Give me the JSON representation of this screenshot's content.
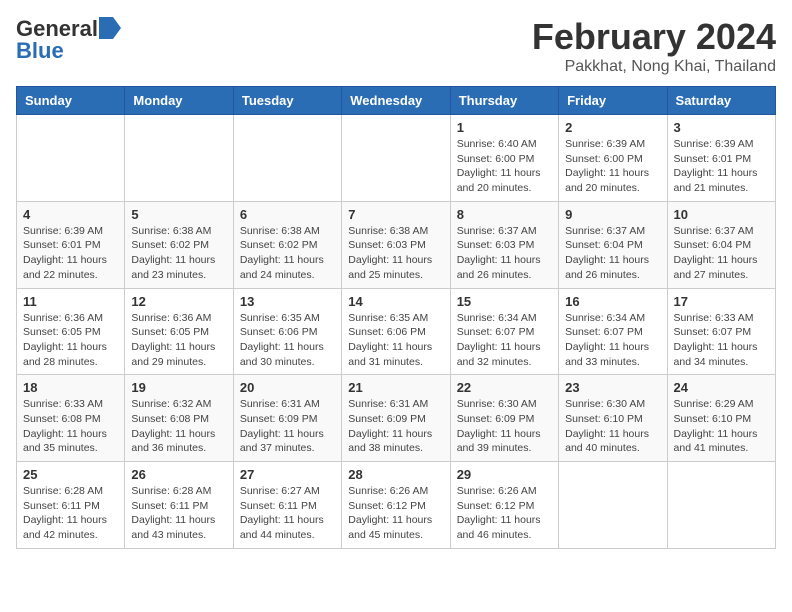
{
  "header": {
    "logo_general": "General",
    "logo_blue": "Blue",
    "main_title": "February 2024",
    "subtitle": "Pakkhat, Nong Khai, Thailand"
  },
  "calendar": {
    "days_of_week": [
      "Sunday",
      "Monday",
      "Tuesday",
      "Wednesday",
      "Thursday",
      "Friday",
      "Saturday"
    ],
    "weeks": [
      [
        {
          "day": "",
          "info": ""
        },
        {
          "day": "",
          "info": ""
        },
        {
          "day": "",
          "info": ""
        },
        {
          "day": "",
          "info": ""
        },
        {
          "day": "1",
          "info": "Sunrise: 6:40 AM\nSunset: 6:00 PM\nDaylight: 11 hours\nand 20 minutes."
        },
        {
          "day": "2",
          "info": "Sunrise: 6:39 AM\nSunset: 6:00 PM\nDaylight: 11 hours\nand 20 minutes."
        },
        {
          "day": "3",
          "info": "Sunrise: 6:39 AM\nSunset: 6:01 PM\nDaylight: 11 hours\nand 21 minutes."
        }
      ],
      [
        {
          "day": "4",
          "info": "Sunrise: 6:39 AM\nSunset: 6:01 PM\nDaylight: 11 hours\nand 22 minutes."
        },
        {
          "day": "5",
          "info": "Sunrise: 6:38 AM\nSunset: 6:02 PM\nDaylight: 11 hours\nand 23 minutes."
        },
        {
          "day": "6",
          "info": "Sunrise: 6:38 AM\nSunset: 6:02 PM\nDaylight: 11 hours\nand 24 minutes."
        },
        {
          "day": "7",
          "info": "Sunrise: 6:38 AM\nSunset: 6:03 PM\nDaylight: 11 hours\nand 25 minutes."
        },
        {
          "day": "8",
          "info": "Sunrise: 6:37 AM\nSunset: 6:03 PM\nDaylight: 11 hours\nand 26 minutes."
        },
        {
          "day": "9",
          "info": "Sunrise: 6:37 AM\nSunset: 6:04 PM\nDaylight: 11 hours\nand 26 minutes."
        },
        {
          "day": "10",
          "info": "Sunrise: 6:37 AM\nSunset: 6:04 PM\nDaylight: 11 hours\nand 27 minutes."
        }
      ],
      [
        {
          "day": "11",
          "info": "Sunrise: 6:36 AM\nSunset: 6:05 PM\nDaylight: 11 hours\nand 28 minutes."
        },
        {
          "day": "12",
          "info": "Sunrise: 6:36 AM\nSunset: 6:05 PM\nDaylight: 11 hours\nand 29 minutes."
        },
        {
          "day": "13",
          "info": "Sunrise: 6:35 AM\nSunset: 6:06 PM\nDaylight: 11 hours\nand 30 minutes."
        },
        {
          "day": "14",
          "info": "Sunrise: 6:35 AM\nSunset: 6:06 PM\nDaylight: 11 hours\nand 31 minutes."
        },
        {
          "day": "15",
          "info": "Sunrise: 6:34 AM\nSunset: 6:07 PM\nDaylight: 11 hours\nand 32 minutes."
        },
        {
          "day": "16",
          "info": "Sunrise: 6:34 AM\nSunset: 6:07 PM\nDaylight: 11 hours\nand 33 minutes."
        },
        {
          "day": "17",
          "info": "Sunrise: 6:33 AM\nSunset: 6:07 PM\nDaylight: 11 hours\nand 34 minutes."
        }
      ],
      [
        {
          "day": "18",
          "info": "Sunrise: 6:33 AM\nSunset: 6:08 PM\nDaylight: 11 hours\nand 35 minutes."
        },
        {
          "day": "19",
          "info": "Sunrise: 6:32 AM\nSunset: 6:08 PM\nDaylight: 11 hours\nand 36 minutes."
        },
        {
          "day": "20",
          "info": "Sunrise: 6:31 AM\nSunset: 6:09 PM\nDaylight: 11 hours\nand 37 minutes."
        },
        {
          "day": "21",
          "info": "Sunrise: 6:31 AM\nSunset: 6:09 PM\nDaylight: 11 hours\nand 38 minutes."
        },
        {
          "day": "22",
          "info": "Sunrise: 6:30 AM\nSunset: 6:09 PM\nDaylight: 11 hours\nand 39 minutes."
        },
        {
          "day": "23",
          "info": "Sunrise: 6:30 AM\nSunset: 6:10 PM\nDaylight: 11 hours\nand 40 minutes."
        },
        {
          "day": "24",
          "info": "Sunrise: 6:29 AM\nSunset: 6:10 PM\nDaylight: 11 hours\nand 41 minutes."
        }
      ],
      [
        {
          "day": "25",
          "info": "Sunrise: 6:28 AM\nSunset: 6:11 PM\nDaylight: 11 hours\nand 42 minutes."
        },
        {
          "day": "26",
          "info": "Sunrise: 6:28 AM\nSunset: 6:11 PM\nDaylight: 11 hours\nand 43 minutes."
        },
        {
          "day": "27",
          "info": "Sunrise: 6:27 AM\nSunset: 6:11 PM\nDaylight: 11 hours\nand 44 minutes."
        },
        {
          "day": "28",
          "info": "Sunrise: 6:26 AM\nSunset: 6:12 PM\nDaylight: 11 hours\nand 45 minutes."
        },
        {
          "day": "29",
          "info": "Sunrise: 6:26 AM\nSunset: 6:12 PM\nDaylight: 11 hours\nand 46 minutes."
        },
        {
          "day": "",
          "info": ""
        },
        {
          "day": "",
          "info": ""
        }
      ]
    ]
  }
}
